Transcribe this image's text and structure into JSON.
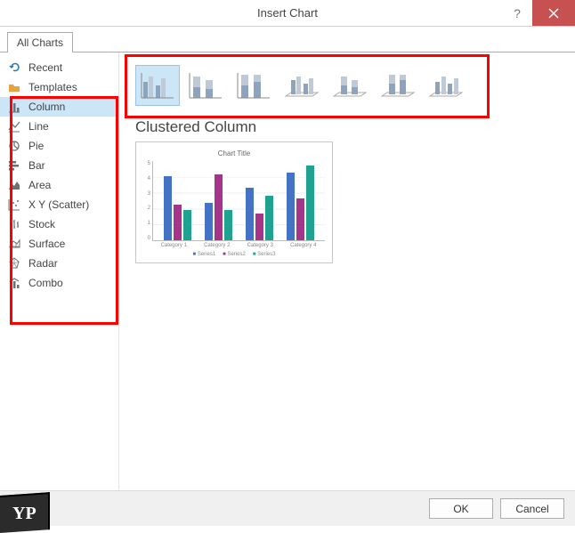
{
  "title": "Insert Chart",
  "tab": "All Charts",
  "sidebar": {
    "items": [
      {
        "label": "Recent",
        "icon": "undo-icon"
      },
      {
        "label": "Templates",
        "icon": "folder-icon"
      },
      {
        "label": "Column",
        "icon": "column-icon",
        "selected": true
      },
      {
        "label": "Line",
        "icon": "line-icon"
      },
      {
        "label": "Pie",
        "icon": "pie-icon"
      },
      {
        "label": "Bar",
        "icon": "bar-icon"
      },
      {
        "label": "Area",
        "icon": "area-icon"
      },
      {
        "label": "X Y (Scatter)",
        "icon": "scatter-icon"
      },
      {
        "label": "Stock",
        "icon": "stock-icon"
      },
      {
        "label": "Surface",
        "icon": "surface-icon"
      },
      {
        "label": "Radar",
        "icon": "radar-icon"
      },
      {
        "label": "Combo",
        "icon": "combo-icon"
      }
    ]
  },
  "subtypes": [
    {
      "name": "clustered-column",
      "selected": true
    },
    {
      "name": "stacked-column"
    },
    {
      "name": "100-stacked-column"
    },
    {
      "name": "3d-clustered-column"
    },
    {
      "name": "3d-stacked-column"
    },
    {
      "name": "3d-100-stacked-column"
    },
    {
      "name": "3d-column"
    }
  ],
  "preview_title": "Clustered Column",
  "chart_data": {
    "type": "bar",
    "title": "Chart Title",
    "categories": [
      "Category 1",
      "Category 2",
      "Category 3",
      "Category 4"
    ],
    "series": [
      {
        "name": "Series1",
        "values": [
          4.3,
          2.5,
          3.5,
          4.5
        ]
      },
      {
        "name": "Series2",
        "values": [
          2.4,
          4.4,
          1.8,
          2.8
        ]
      },
      {
        "name": "Series3",
        "values": [
          2.0,
          2.0,
          3.0,
          5.0
        ]
      }
    ],
    "ylim": [
      0,
      5
    ],
    "yticks": [
      0,
      1,
      2,
      3,
      4,
      5
    ],
    "colors": {
      "Series1": "#4472c4",
      "Series2": "#a5358b",
      "Series3": "#1fa28f"
    }
  },
  "buttons": {
    "ok": "OK",
    "cancel": "Cancel"
  },
  "badge": "YP"
}
